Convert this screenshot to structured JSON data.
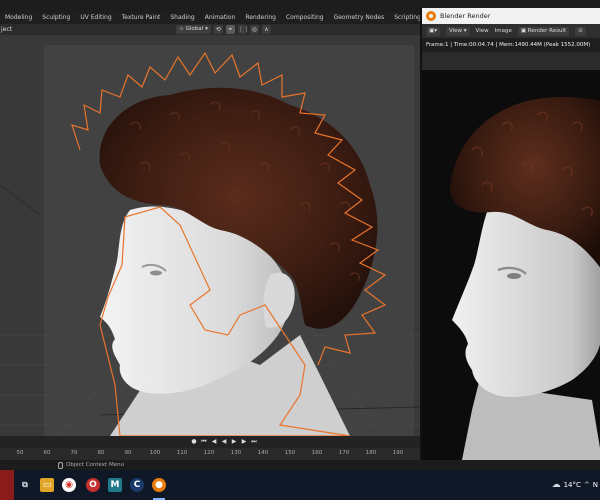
{
  "workspace_tabs": [
    "Modeling",
    "Sculpting",
    "UV Editing",
    "Texture Paint",
    "Shading",
    "Animation",
    "Rendering",
    "Compositing",
    "Geometry Nodes",
    "Scripting"
  ],
  "viewport": {
    "mode_label": "ject",
    "transform_orientation": "Global"
  },
  "timeline": {
    "ticks": [
      "50",
      "60",
      "70",
      "80",
      "90",
      "100",
      "110",
      "120",
      "130",
      "140",
      "150",
      "160",
      "170",
      "180",
      "190"
    ]
  },
  "status": {
    "context_menu": "Object Context Menu"
  },
  "render_window": {
    "title": "Blender Render",
    "menu": {
      "view": "View",
      "view2": "View",
      "image": "Image",
      "slot": "Render Result"
    },
    "info": "Frame:1 | Time:00:04.74 | Mem:1490.44M (Peak 1552.00M)"
  },
  "taskbar": {
    "temperature": "14°C",
    "tray_letter": "N"
  },
  "colors": {
    "selection_outline": "#e8742c",
    "hair": "#4a2216",
    "skin": "#e4e4e4"
  }
}
